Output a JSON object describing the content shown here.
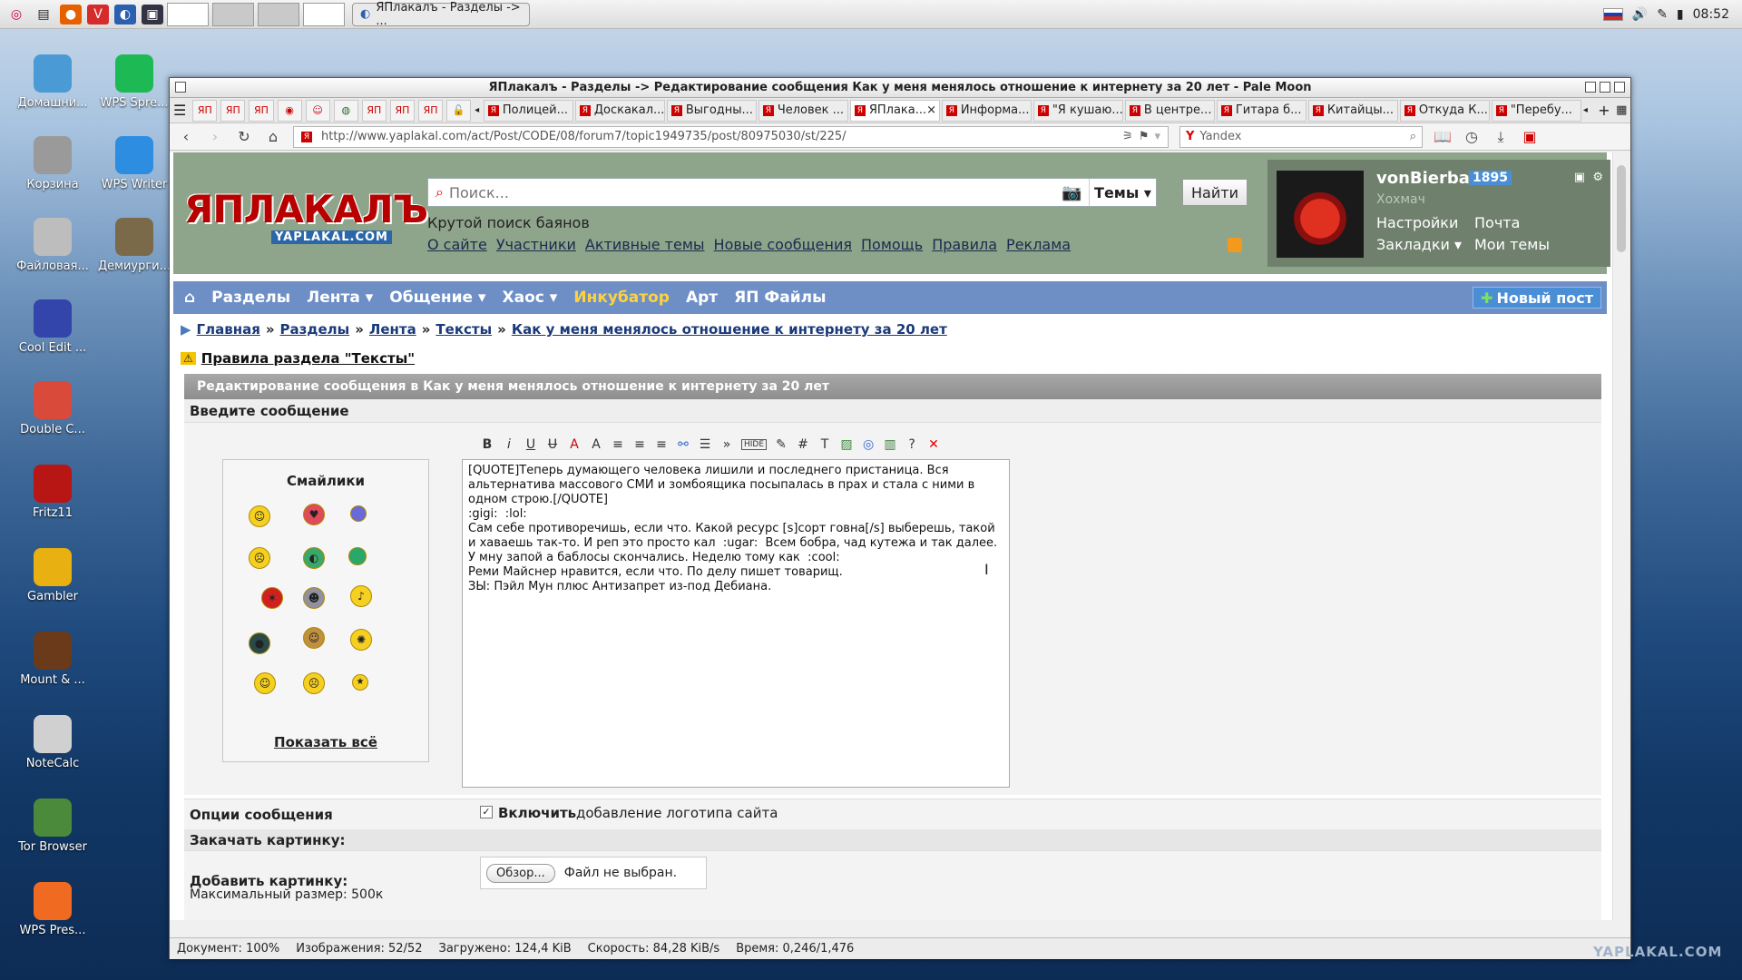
{
  "taskbar": {
    "task_title": "ЯПлакалъ - Разделы -> ...",
    "clock": "08:52"
  },
  "desktop": {
    "icons": [
      {
        "label": "Домашни...",
        "color": "#4a9ad6"
      },
      {
        "label": "WPS Spre...",
        "color": "#1db954"
      },
      {
        "label": "Корзина",
        "color": "#9a9a9a"
      },
      {
        "label": "WPS Writer",
        "color": "#2d8de0"
      },
      {
        "label": "Файловая...",
        "color": "#bdbdbd"
      },
      {
        "label": "Демиурги...",
        "color": "#7a6a4a"
      },
      {
        "label": "Cool Edit ...",
        "color": "#3344aa"
      },
      {
        "label": "Double C...",
        "color": "#d94a3a"
      },
      {
        "label": "Fritz11",
        "color": "#b81515"
      },
      {
        "label": "Gambler",
        "color": "#e8b010"
      },
      {
        "label": "Mount & ...",
        "color": "#6a3a1a"
      },
      {
        "label": "NoteCalc",
        "color": "#d0d0d0"
      },
      {
        "label": "Tor Browser",
        "color": "#4a8a3a"
      },
      {
        "label": "WPS Pres...",
        "color": "#f06a22"
      }
    ]
  },
  "browser": {
    "title": "ЯПлакалъ - Разделы -> Редактирование сообщения Как у меня менялось отношение к интернету за 20 лет - Pale Moon",
    "tabs": [
      "Полицей...",
      "Доскакал...",
      "Выгодны...",
      "Человек ...",
      "ЯПлака...",
      "Информа...",
      "\"Я кушаю...",
      "В центре...",
      "Гитара б...",
      "Китайцы...",
      "Откуда К...",
      "\"Перебу..."
    ],
    "url": "http://www.yaplakal.com/act/Post/CODE/08/forum7/topic1949735/post/80975030/st/225/",
    "search_engine": "Yandex",
    "status": {
      "doc": "Документ: 100%",
      "images": "Изображения: 52/52",
      "loaded": "Загружено: 124,4 KiB",
      "speed": "Скорость: 84,28 KiB/s",
      "time": "Время: 0,246/1,476"
    }
  },
  "site": {
    "logo_text": "ЯПЛАКАЛЪ",
    "logo_sub": "YAPLAKAL.COM",
    "search_placeholder": "Поиск...",
    "search_scope": "Темы",
    "search_button": "Найти",
    "slogan": "Крутой поиск баянов",
    "top_links": [
      "О сайте",
      "Участники",
      "Активные темы",
      "Новые сообщения",
      "Помощь",
      "Правила",
      "Реклама"
    ],
    "user": {
      "name": "vonBierbah",
      "count": "1895",
      "rank": "Хохмач",
      "links": [
        "Настройки",
        "Почта",
        "Закладки ▾",
        "Мои темы"
      ]
    },
    "menu": [
      "Разделы",
      "Лента ▾",
      "Общение ▾",
      "Хаос ▾",
      "Инкубатор",
      "Арт",
      "ЯП Файлы"
    ],
    "new_post": "Новый пост",
    "breadcrumbs": [
      "Главная",
      "Разделы",
      "Лента",
      "Тексты",
      "Как у меня менялось отношение к интернету за 20 лет"
    ],
    "rules_link": "Правила раздела \"Тексты\"",
    "form": {
      "header": "Редактирование сообщения в Как у меня менялось отношение к интернету за 20 лет",
      "enter_message": "Введите сообщение",
      "smileys_title": "Смайлики",
      "show_all": "Показать всё",
      "message": "[QUOTE]Теперь думающего человека лишили и последнего пристаница. Вся альтернатива массового СМИ и зомбоящика посыпалась в прах и стала с ними в одном строю.[/QUOTE]\n:gigi:  :lol:\nСам себе противоречишь, если что. Какой ресурс [s]сорт говна[/s] выберешь, такой и хаваешь так-то. И реп это просто кал  :ugar:  Всем бобра, чад кутежа и так далее. У мну запой а баблосы скончались. Неделю тому как  :cool:\nРеми Майснер нравится, если что. По делу пишет товарищ.\nЗЫ: Пэйл Мун плюс Антизапрет из-под Дебиана.",
      "options_label": "Опции сообщения",
      "option_bold": "Включить",
      "option_text": "добавление логотипа сайта",
      "upload_label": "Закачать картинку:",
      "add_picture": "Добавить картинку:",
      "max_size": "Максимальный размер: 500к",
      "browse_button": "Обзор...",
      "no_file": "Файл не выбран."
    }
  },
  "watermark": "YAPLAKAL.COM"
}
